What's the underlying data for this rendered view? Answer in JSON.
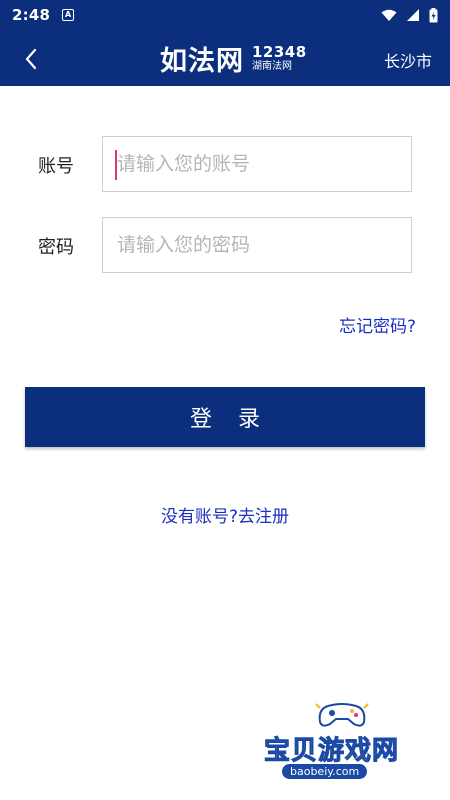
{
  "status_bar": {
    "time": "2:48",
    "notification_letter": "A",
    "icons": [
      "wifi-icon",
      "signal-icon",
      "battery-icon"
    ]
  },
  "header": {
    "logo_main": "如法网",
    "logo_number": "12348",
    "logo_sub": "湖南法网",
    "city": "长沙市",
    "back_icon": "chevron-left-icon",
    "background_color": "#0b2f7c"
  },
  "form": {
    "account_label": "账号",
    "account_placeholder": "请输入您的账号",
    "account_value": "",
    "password_label": "密码",
    "password_placeholder": "请输入您的密码",
    "password_value": ""
  },
  "forgot_password": "忘记密码?",
  "login_button": "登录",
  "register_link": "没有账号?去注册",
  "watermark": {
    "text": "宝贝游戏网",
    "url": "baobeiy.com"
  },
  "colors": {
    "primary": "#0b2f7c",
    "link": "#1c2fbf",
    "caret": "#e0357a"
  }
}
